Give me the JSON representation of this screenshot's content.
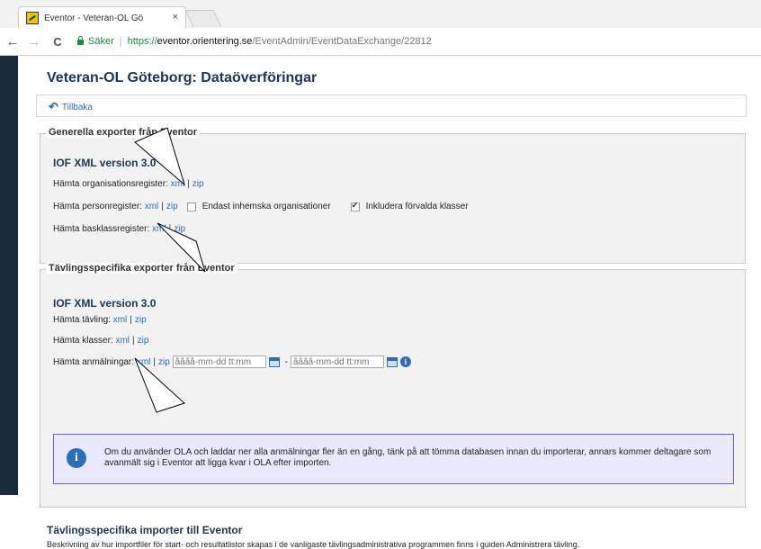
{
  "browser": {
    "tab_title": "Eventor - Veteran-OL Gö",
    "tab_close": "×",
    "back": "←",
    "forward": "→",
    "reload": "C",
    "secure_label": "Säker",
    "url_scheme": "https://",
    "url_host": "eventor.orientering.se",
    "url_path": "/EventAdmin/EventDataExchange/22812"
  },
  "page": {
    "title": "Veteran-OL Göteborg: Dataöverföringar",
    "back_label": "Tillbaka"
  },
  "general": {
    "legend": "Generella exporter från Eventor",
    "heading": "IOF XML version 3.0",
    "org_label": "Hämta organisationsregister:",
    "person_label": "Hämta personregister:",
    "baseclass_label": "Hämta basklassregister:",
    "xml": "xml",
    "zip": "zip",
    "pipe": "|",
    "checkbox_domestic": {
      "label": "Endast inhemska organisationer",
      "checked": false
    },
    "checkbox_default_classes": {
      "label": "Inkludera förvalda klasser",
      "checked": true
    }
  },
  "competition": {
    "legend": "Tävlingsspecifika exporter från Eventor",
    "heading": "IOF XML version 3.0",
    "event_label": "Hämta tävling:",
    "classes_label": "Hämta klasser:",
    "entries_label": "Hämta anmälningar:",
    "date_placeholder_from": "åååå-mm-dd tt:mm",
    "date_placeholder_to": "åååå-mm-dd tt:mm",
    "dash": "-",
    "info_glyph": "i",
    "notice": "Om du använder OLA och laddar ner alla anmälningar fler än en gång, tänk på att tömma databasen innan du importerar, annars kommer deltagare som avanmält sig i Eventor att ligga kvar i OLA efter importen."
  },
  "imports": {
    "title": "Tävlingsspecifika importer till Eventor",
    "description": "Beskrivning av hur importfiler för start- och resultatlistor skapas i de vanligaste tävlingsadministrativa programmen finns i guiden Administrera tävling."
  }
}
